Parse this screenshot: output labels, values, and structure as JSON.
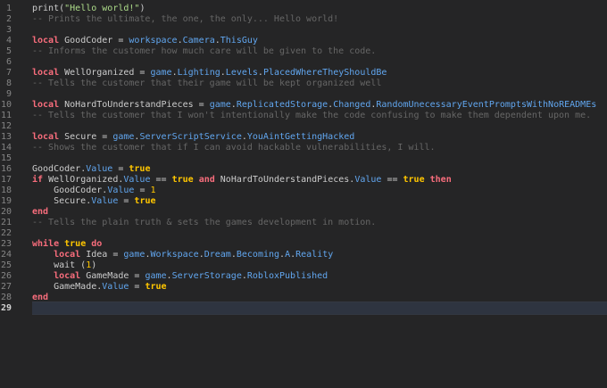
{
  "editor": {
    "current_line": 29,
    "colors": {
      "background": "#252526",
      "gutter_text": "#858585",
      "keyword": "#f86d7c",
      "property": "#61a6ef",
      "string": "#aedd8a",
      "comment": "#666666",
      "boolean": "#ffc600",
      "text": "#cccccc"
    },
    "lines": [
      {
        "n": "1",
        "tokens": [
          {
            "t": "fn",
            "v": "print"
          },
          {
            "t": "op",
            "v": "("
          },
          {
            "t": "str",
            "v": "\"Hello world!\""
          },
          {
            "t": "op",
            "v": ")"
          }
        ]
      },
      {
        "n": "2",
        "tokens": [
          {
            "t": "com",
            "v": "-- Prints the ultimate, the one, the only... Hello world!"
          }
        ]
      },
      {
        "n": "3",
        "tokens": []
      },
      {
        "n": "4",
        "tokens": [
          {
            "t": "kw",
            "v": "local"
          },
          {
            "t": "plain",
            "v": " GoodCoder = "
          },
          {
            "t": "prop",
            "v": "workspace"
          },
          {
            "t": "op",
            "v": "."
          },
          {
            "t": "prop",
            "v": "Camera"
          },
          {
            "t": "op",
            "v": "."
          },
          {
            "t": "prop",
            "v": "ThisGuy"
          }
        ]
      },
      {
        "n": "5",
        "tokens": [
          {
            "t": "com",
            "v": "-- Informs the customer how much care will be given to the code."
          }
        ]
      },
      {
        "n": "6",
        "tokens": []
      },
      {
        "n": "7",
        "tokens": [
          {
            "t": "kw",
            "v": "local"
          },
          {
            "t": "plain",
            "v": " WellOrganized = "
          },
          {
            "t": "prop",
            "v": "game"
          },
          {
            "t": "op",
            "v": "."
          },
          {
            "t": "prop",
            "v": "Lighting"
          },
          {
            "t": "op",
            "v": "."
          },
          {
            "t": "prop",
            "v": "Levels"
          },
          {
            "t": "op",
            "v": "."
          },
          {
            "t": "prop",
            "v": "PlacedWhereTheyShouldBe"
          }
        ]
      },
      {
        "n": "8",
        "tokens": [
          {
            "t": "com",
            "v": "-- Tells the customer that their game will be kept organized well"
          }
        ]
      },
      {
        "n": "9",
        "tokens": []
      },
      {
        "n": "10",
        "tokens": [
          {
            "t": "kw",
            "v": "local"
          },
          {
            "t": "plain",
            "v": " NoHardToUnderstandPieces = "
          },
          {
            "t": "prop",
            "v": "game"
          },
          {
            "t": "op",
            "v": "."
          },
          {
            "t": "prop",
            "v": "ReplicatedStorage"
          },
          {
            "t": "op",
            "v": "."
          },
          {
            "t": "prop",
            "v": "Changed"
          },
          {
            "t": "op",
            "v": "."
          },
          {
            "t": "prop",
            "v": "RandomUnecessaryEventPromptsWithNoREADMEs"
          }
        ]
      },
      {
        "n": "11",
        "tokens": [
          {
            "t": "com",
            "v": "-- Tells the customer that I won't intentionally make the code confusing to make them dependent upon me."
          }
        ]
      },
      {
        "n": "12",
        "tokens": []
      },
      {
        "n": "13",
        "tokens": [
          {
            "t": "kw",
            "v": "local"
          },
          {
            "t": "plain",
            "v": " Secure = "
          },
          {
            "t": "prop",
            "v": "game"
          },
          {
            "t": "op",
            "v": "."
          },
          {
            "t": "prop",
            "v": "ServerScriptService"
          },
          {
            "t": "op",
            "v": "."
          },
          {
            "t": "prop",
            "v": "YouAintGettingHacked"
          }
        ]
      },
      {
        "n": "14",
        "tokens": [
          {
            "t": "com",
            "v": "-- Shows the customer that if I can avoid hackable vulnerabilities, I will."
          }
        ]
      },
      {
        "n": "15",
        "tokens": []
      },
      {
        "n": "16",
        "tokens": [
          {
            "t": "plain",
            "v": "GoodCoder"
          },
          {
            "t": "op",
            "v": "."
          },
          {
            "t": "prop",
            "v": "Value"
          },
          {
            "t": "plain",
            "v": " = "
          },
          {
            "t": "bool",
            "v": "true"
          }
        ]
      },
      {
        "n": "17",
        "tokens": [
          {
            "t": "kw",
            "v": "if"
          },
          {
            "t": "plain",
            "v": " WellOrganized"
          },
          {
            "t": "op",
            "v": "."
          },
          {
            "t": "prop",
            "v": "Value"
          },
          {
            "t": "plain",
            "v": " == "
          },
          {
            "t": "bool",
            "v": "true"
          },
          {
            "t": "plain",
            "v": " "
          },
          {
            "t": "kw",
            "v": "and"
          },
          {
            "t": "plain",
            "v": " NoHardToUnderstandPieces"
          },
          {
            "t": "op",
            "v": "."
          },
          {
            "t": "prop",
            "v": "Value"
          },
          {
            "t": "plain",
            "v": " == "
          },
          {
            "t": "bool",
            "v": "true"
          },
          {
            "t": "plain",
            "v": " "
          },
          {
            "t": "kw",
            "v": "then"
          }
        ]
      },
      {
        "n": "18",
        "tokens": [
          {
            "t": "plain",
            "v": "    GoodCoder"
          },
          {
            "t": "op",
            "v": "."
          },
          {
            "t": "prop",
            "v": "Value"
          },
          {
            "t": "plain",
            "v": " = "
          },
          {
            "t": "num",
            "v": "1"
          }
        ]
      },
      {
        "n": "19",
        "tokens": [
          {
            "t": "plain",
            "v": "    Secure"
          },
          {
            "t": "op",
            "v": "."
          },
          {
            "t": "prop",
            "v": "Value"
          },
          {
            "t": "plain",
            "v": " = "
          },
          {
            "t": "bool",
            "v": "true"
          }
        ]
      },
      {
        "n": "20",
        "tokens": [
          {
            "t": "kw",
            "v": "end"
          }
        ]
      },
      {
        "n": "21",
        "tokens": [
          {
            "t": "com",
            "v": "-- Tells the plain truth & sets the games development in motion."
          }
        ]
      },
      {
        "n": "22",
        "tokens": []
      },
      {
        "n": "23",
        "tokens": [
          {
            "t": "kw",
            "v": "while"
          },
          {
            "t": "plain",
            "v": " "
          },
          {
            "t": "bool",
            "v": "true"
          },
          {
            "t": "plain",
            "v": " "
          },
          {
            "t": "kw",
            "v": "do"
          }
        ]
      },
      {
        "n": "24",
        "tokens": [
          {
            "t": "plain",
            "v": "    "
          },
          {
            "t": "kw",
            "v": "local"
          },
          {
            "t": "plain",
            "v": " Idea = "
          },
          {
            "t": "prop",
            "v": "game"
          },
          {
            "t": "op",
            "v": "."
          },
          {
            "t": "prop",
            "v": "Workspace"
          },
          {
            "t": "op",
            "v": "."
          },
          {
            "t": "prop",
            "v": "Dream"
          },
          {
            "t": "op",
            "v": "."
          },
          {
            "t": "prop",
            "v": "Becoming"
          },
          {
            "t": "op",
            "v": "."
          },
          {
            "t": "prop",
            "v": "A"
          },
          {
            "t": "op",
            "v": "."
          },
          {
            "t": "prop",
            "v": "Reality"
          }
        ]
      },
      {
        "n": "25",
        "tokens": [
          {
            "t": "plain",
            "v": "    wait ("
          },
          {
            "t": "num",
            "v": "1"
          },
          {
            "t": "plain",
            "v": ")"
          }
        ]
      },
      {
        "n": "26",
        "tokens": [
          {
            "t": "plain",
            "v": "    "
          },
          {
            "t": "kw",
            "v": "local"
          },
          {
            "t": "plain",
            "v": " GameMade = "
          },
          {
            "t": "prop",
            "v": "game"
          },
          {
            "t": "op",
            "v": "."
          },
          {
            "t": "prop",
            "v": "ServerStorage"
          },
          {
            "t": "op",
            "v": "."
          },
          {
            "t": "prop",
            "v": "RobloxPublished"
          }
        ]
      },
      {
        "n": "27",
        "tokens": [
          {
            "t": "plain",
            "v": "    GameMade"
          },
          {
            "t": "op",
            "v": "."
          },
          {
            "t": "prop",
            "v": "Value"
          },
          {
            "t": "plain",
            "v": " = "
          },
          {
            "t": "bool",
            "v": "true"
          }
        ]
      },
      {
        "n": "28",
        "tokens": [
          {
            "t": "kw",
            "v": "end"
          }
        ]
      },
      {
        "n": "29",
        "tokens": []
      }
    ]
  }
}
